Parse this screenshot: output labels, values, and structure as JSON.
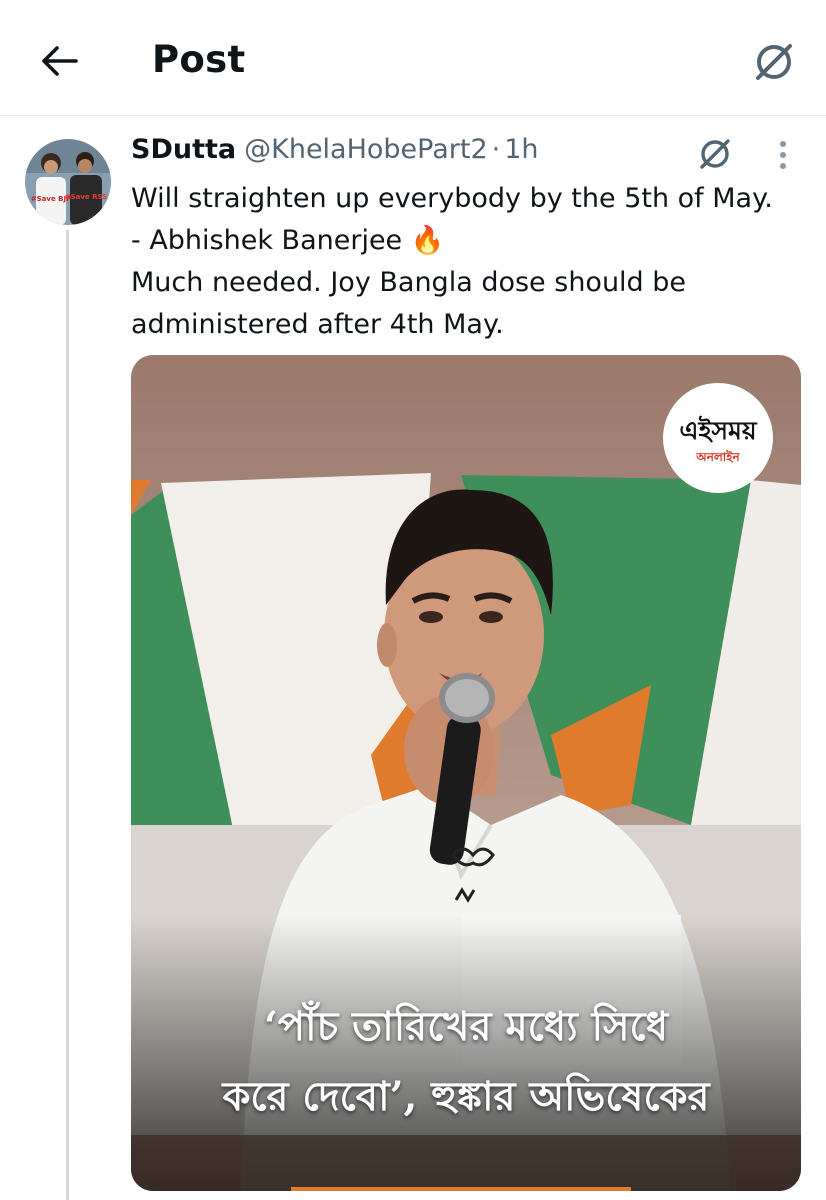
{
  "header": {
    "title": "Post"
  },
  "tweet": {
    "display_name": "SDutta",
    "handle": "@KhelaHobePart2",
    "separator": "·",
    "time": "1h",
    "lines": [
      "Will straighten up everybody by the 5th of May.",
      "- Abhishek Banerjee 🔥",
      "Much needed. Joy Bangla dose should be",
      "administered after 4th May."
    ]
  },
  "avatar": {
    "shirt_left": "#Save BJP",
    "shirt_right": "#Save RSS"
  },
  "media": {
    "logo_main": "এইসময়",
    "logo_sub": "অনলাইন",
    "caption_line1": "‘পাঁচ তারিখের মধ্যে সিধে",
    "caption_line2": "করে দেবো’, হুঙ্কার অভিষেকের"
  },
  "icons": {
    "back": "arrow-left-icon",
    "grok": "grok-icon",
    "more": "more-vertical-icon",
    "fire": "fire-emoji"
  },
  "colors": {
    "text": "#0f1419",
    "secondary": "#536471",
    "divider": "#e6e9ec",
    "thread_line": "#cfd9de",
    "saffron": "#e07b2e",
    "green": "#3f8f5a"
  }
}
